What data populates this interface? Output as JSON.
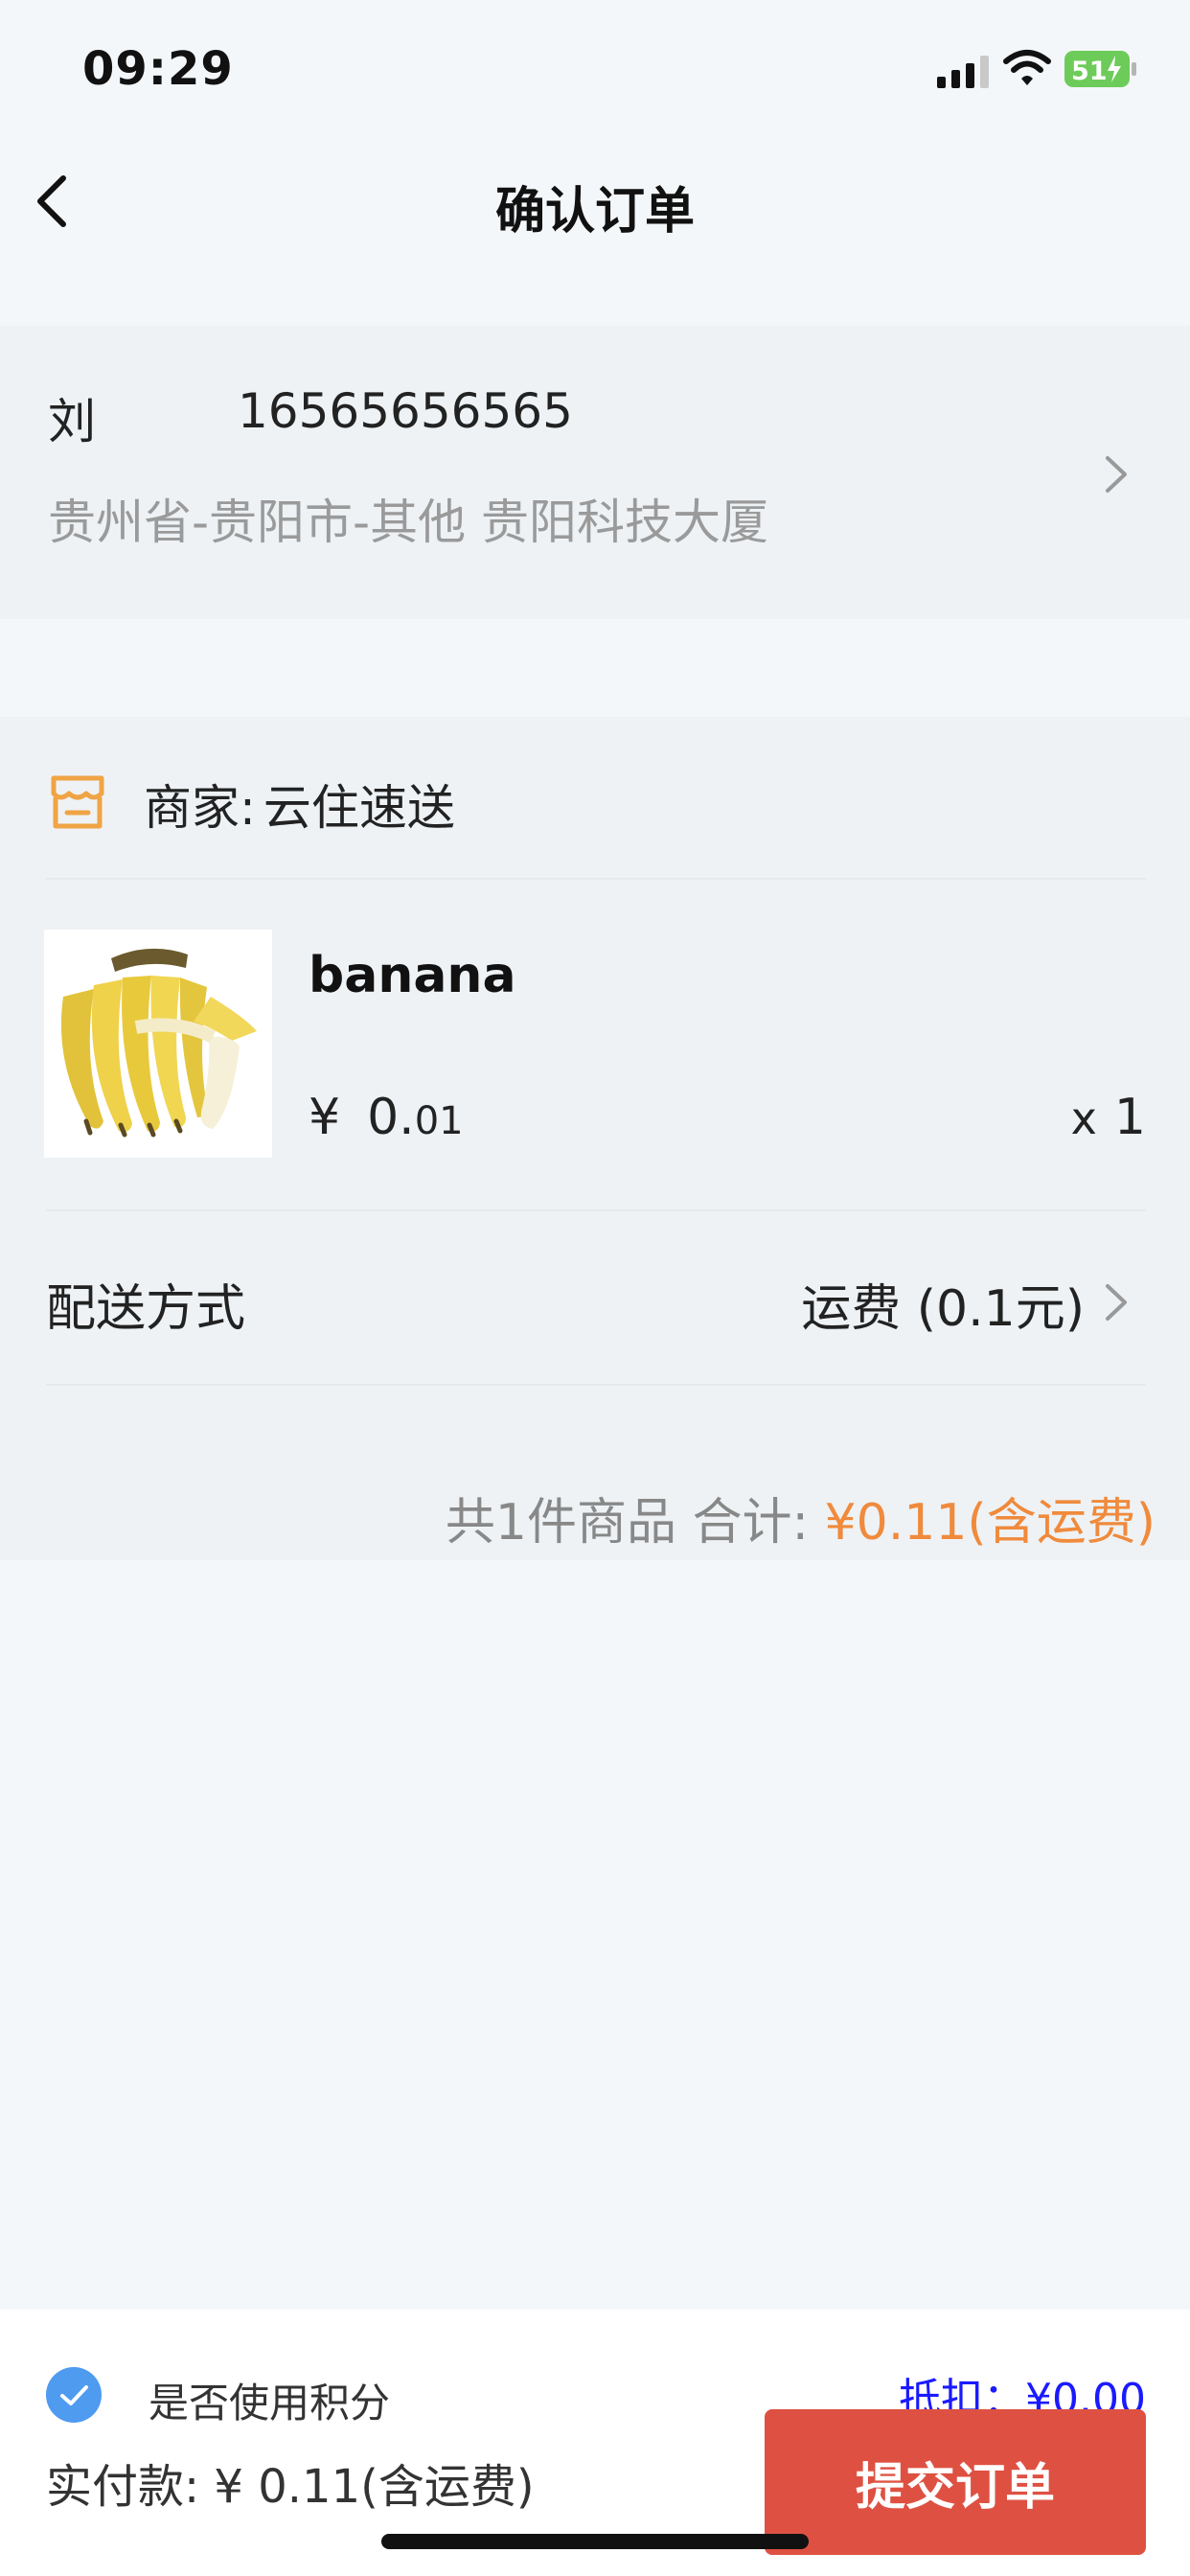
{
  "status_bar": {
    "time": "09:29",
    "battery": "51"
  },
  "header": {
    "title": "确认订单"
  },
  "address": {
    "name": "刘",
    "phone": "16565656565",
    "detail": "贵州省-贵阳市-其他 贵阳科技大厦"
  },
  "merchant": {
    "label": "商家:",
    "name": "云住速送"
  },
  "product": {
    "name": "banana",
    "price_symbol": "¥",
    "price_integer": "0.",
    "price_decimal": "01",
    "quantity_prefix": "x",
    "quantity": "1"
  },
  "delivery": {
    "label": "配送方式",
    "value": "运费 (0.1元)"
  },
  "summary": {
    "count_text": "共1件商品 合计:",
    "total": "¥0.11(含运费)"
  },
  "bottom": {
    "points_label": "是否使用积分",
    "points_checked": true,
    "deduct_text": "抵扣：¥0.00",
    "pay_text": "实付款: ¥ 0.11(含运费)",
    "submit_label": "提交订单"
  },
  "colors": {
    "accent_orange": "#f08a3c",
    "submit_red": "#de5142",
    "check_blue": "#4e9bf0",
    "deduct_blue": "#1a1aff"
  }
}
